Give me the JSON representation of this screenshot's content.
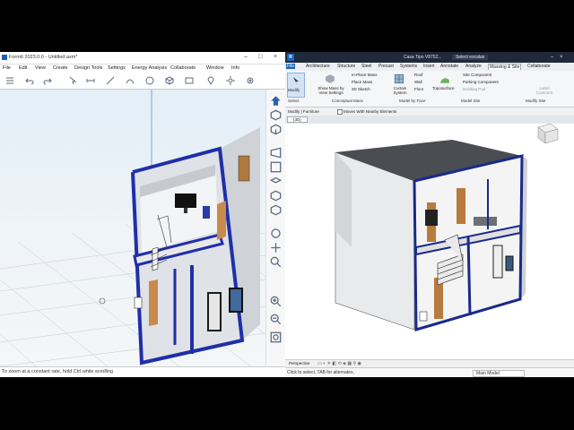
{
  "formit": {
    "title": "FormIt 2023.0.0 - Untitled.axm*",
    "menu": [
      "File",
      "Edit",
      "View",
      "Create",
      "Design Tools",
      "Settings",
      "Energy Analysis",
      "Collaborate",
      "Window",
      "Info"
    ],
    "status": "To zoom at a constant rate, hold Ctrl while scrolling",
    "colors": {
      "accent_blue": "#1f2fa8",
      "wall": "#d8dbe0",
      "sky": "#e3eef7"
    }
  },
  "revit": {
    "title_file": "Casa Tipo V8752...",
    "title_search": "Select escalas",
    "tabs": [
      "File",
      "Architecture",
      "Structure",
      "Steel",
      "Precast",
      "Systems",
      "Insert",
      "Annotate",
      "Analyze",
      "Massing & Site",
      "Collaborate"
    ],
    "active_tab": "Massing & Site",
    "ribbon": {
      "modify": "Modify",
      "select": "Select",
      "show_mass": "Show Mass by View Settings",
      "in_place_mass": "In-Place Mass",
      "place_mass": "Place Mass",
      "sketch_3d": "3D Sketch",
      "curtain_system": "Curtain System",
      "roof": "Roof",
      "wall": "Wall",
      "floor": "Floor",
      "toposurface": "Toposurface",
      "site_component": "Site Component",
      "parking_component": "Parking Component",
      "building_pad": "Building Pad",
      "label_contours": "Label Contours",
      "panels": [
        "Select",
        "Conceptual Mass",
        "Model by Face",
        "Model Site",
        "Modify Site"
      ]
    },
    "options_bar": {
      "context": "Modify | Furniture",
      "checkbox": "Moves With Nearby Elements"
    },
    "doc_tab": "{3D}",
    "view_bar": {
      "projection": "Perspective"
    },
    "status": {
      "hint": "Click to select, TAB for alternates,",
      "model": "Main Model"
    }
  }
}
